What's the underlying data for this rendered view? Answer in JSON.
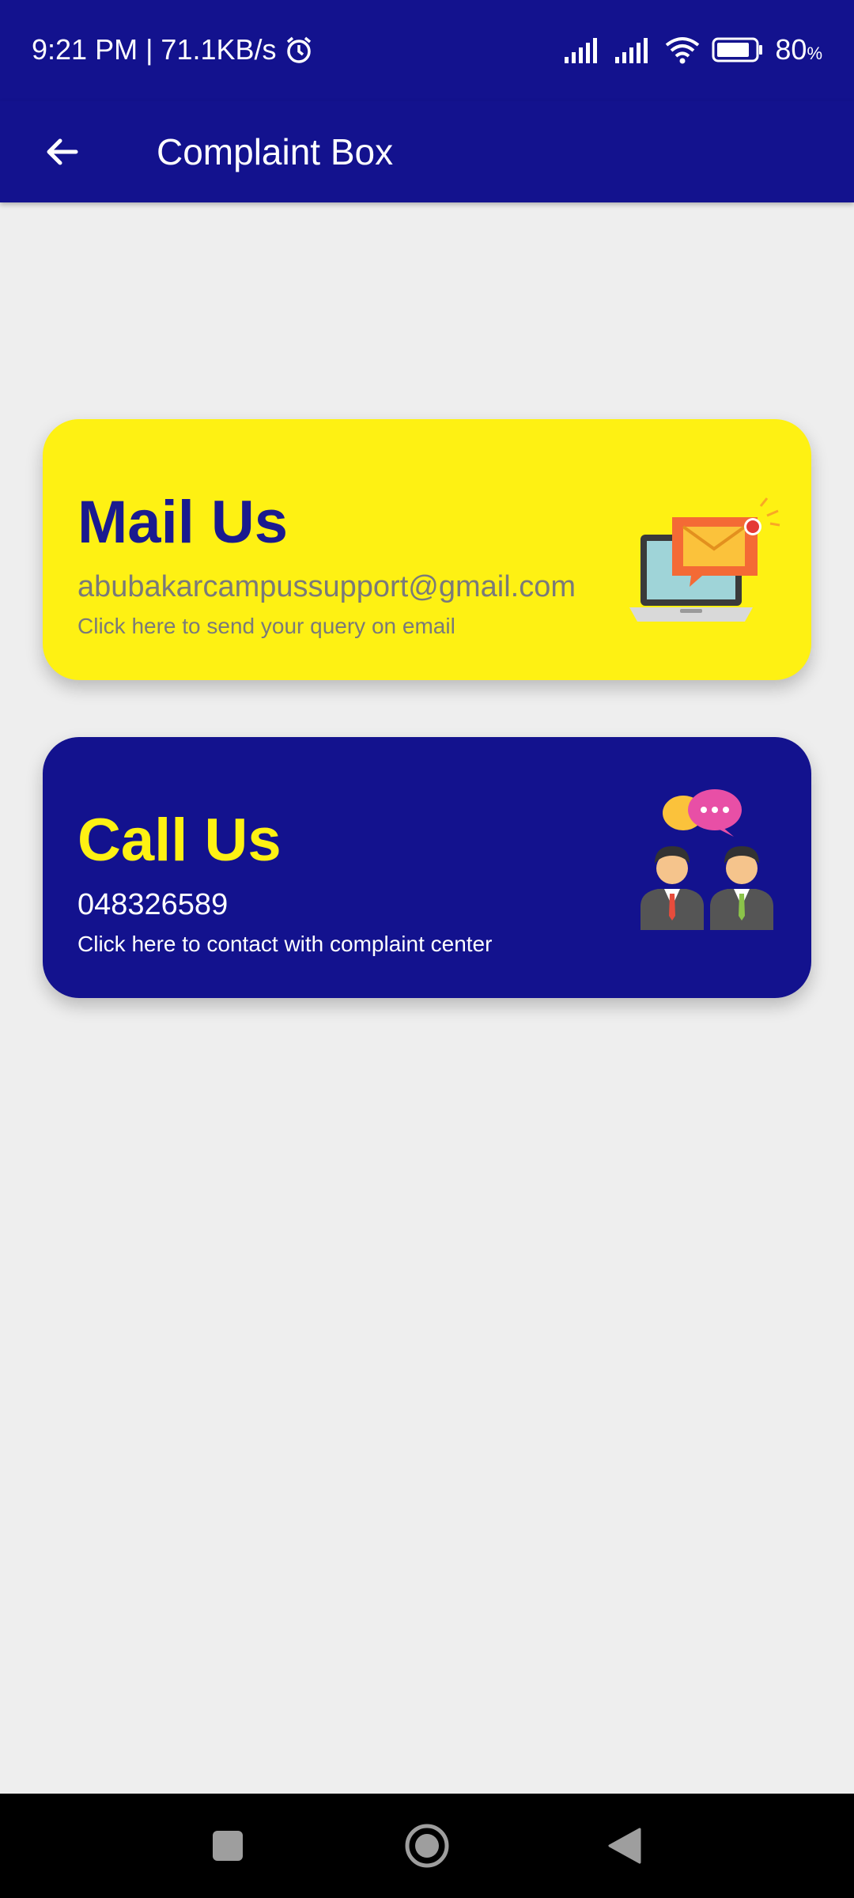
{
  "status": {
    "time_speed": "9:21 PM | 71.1KB/s",
    "battery": "80",
    "battery_unit": "%",
    "icons": [
      "alarm-icon",
      "signal-icon",
      "signal-icon",
      "wifi-icon",
      "battery-icon"
    ]
  },
  "appbar": {
    "title": "Complaint Box",
    "back_icon": "arrow-left-icon"
  },
  "cards": {
    "mail": {
      "title": "Mail Us",
      "email": "abubakarcampussupport@gmail.com",
      "description": "Click here to send your query on email",
      "illustration": "laptop-mail-icon",
      "background": "#fef113",
      "title_color": "#1a1a8f"
    },
    "call": {
      "title": "Call Us",
      "phone": "048326589",
      "description": "Click here to contact with complaint center",
      "illustration": "people-chat-icon",
      "background": "#13128e",
      "title_color": "#fef113"
    }
  },
  "navbar": {
    "recents_icon": "square-icon",
    "home_icon": "circle-icon",
    "back_icon": "triangle-back-icon"
  },
  "colors": {
    "primary": "#13128e",
    "accent": "#fef113",
    "background": "#eeeeee"
  }
}
